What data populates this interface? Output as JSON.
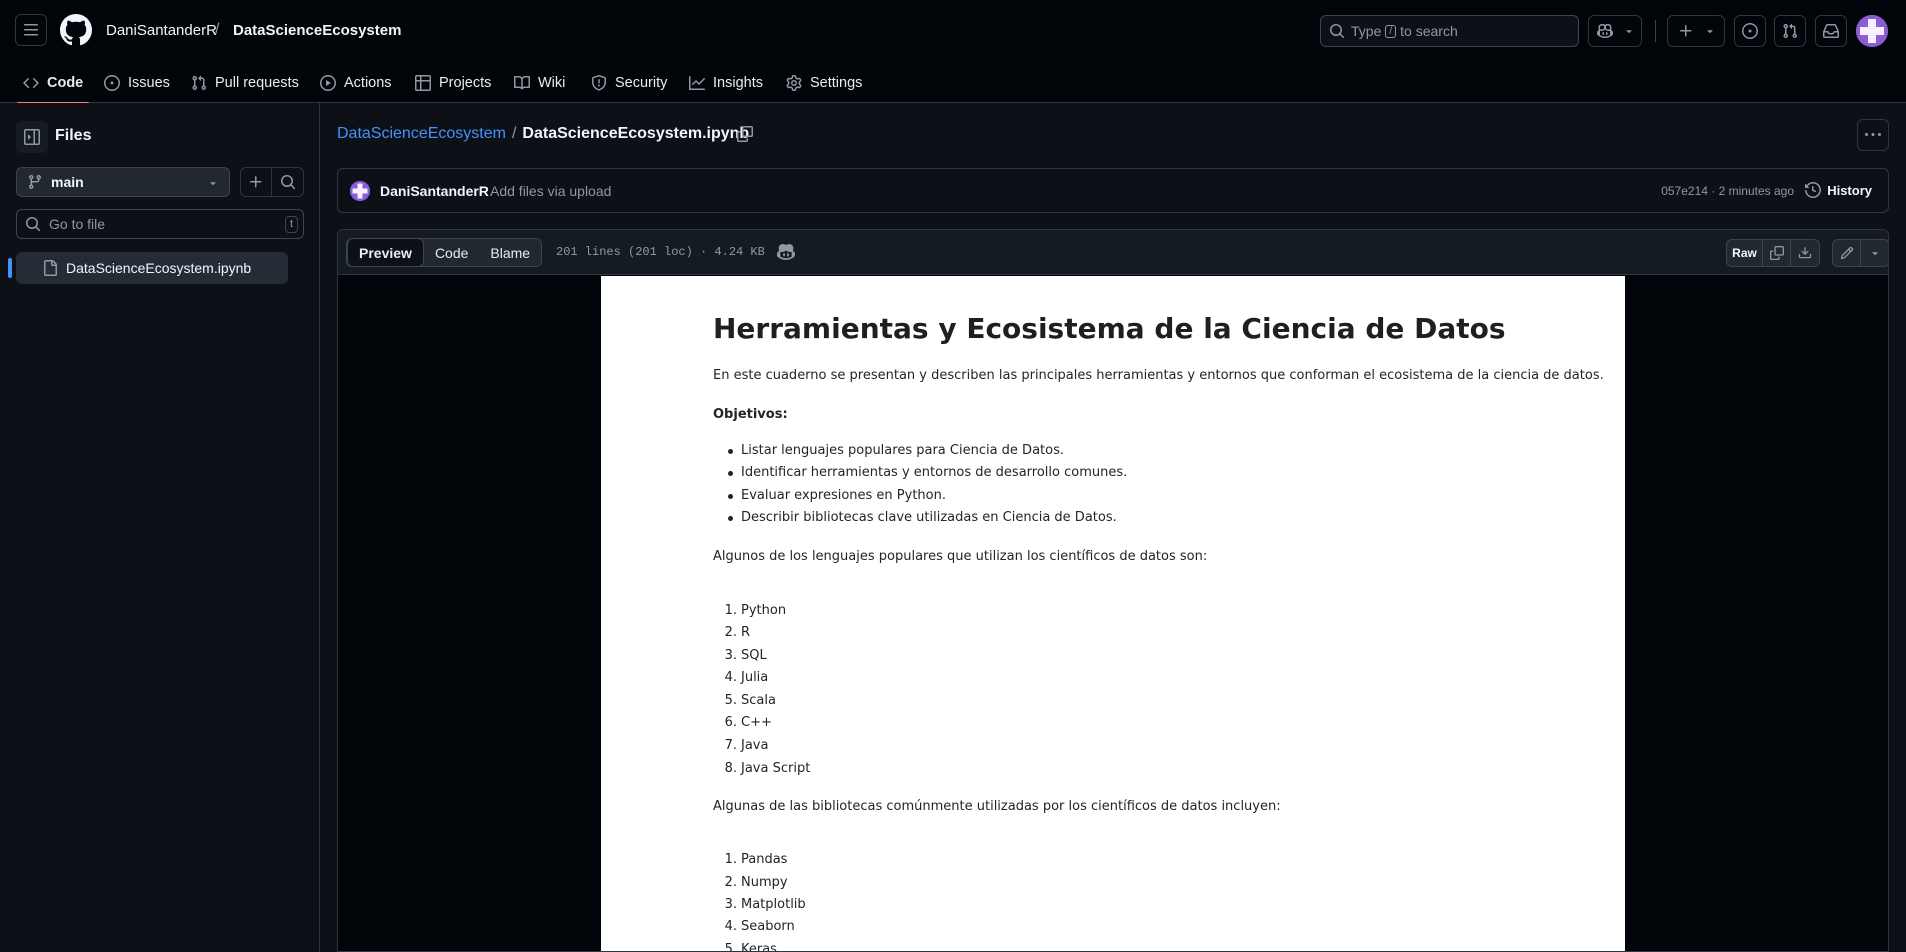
{
  "header": {
    "owner": "DaniSantanderR",
    "separator": "/",
    "repo": "DataScienceEcosystem",
    "search_prefix": "Type",
    "search_key": "/",
    "search_suffix": "to search"
  },
  "repo_nav": [
    {
      "label": "Code",
      "icon": "code-icon",
      "active": true
    },
    {
      "label": "Issues",
      "icon": "issue-icon"
    },
    {
      "label": "Pull requests",
      "icon": "pull-request-icon"
    },
    {
      "label": "Actions",
      "icon": "play-icon"
    },
    {
      "label": "Projects",
      "icon": "table-icon"
    },
    {
      "label": "Wiki",
      "icon": "book-icon"
    },
    {
      "label": "Security",
      "icon": "shield-icon"
    },
    {
      "label": "Insights",
      "icon": "graph-icon"
    },
    {
      "label": "Settings",
      "icon": "gear-icon"
    }
  ],
  "sidebar": {
    "title": "Files",
    "branch": "main",
    "goto_placeholder": "Go to file",
    "goto_key": "t",
    "files": [
      "DataScienceEcosystem.ipynb"
    ]
  },
  "path": {
    "repo": "DataScienceEcosystem",
    "separator": "/",
    "file": "DataScienceEcosystem.ipynb"
  },
  "commit": {
    "author": "DaniSantanderR",
    "message": "Add files via upload",
    "meta": "057e214 · 2 minutes ago",
    "history_label": "History"
  },
  "file_header": {
    "tabs": [
      "Preview",
      "Code",
      "Blame"
    ],
    "active_tab": "Preview",
    "info": "201 lines (201 loc) · 4.24 KB",
    "raw_label": "Raw"
  },
  "notebook": {
    "title": "Herramientas y Ecosistema de la Ciencia de Datos",
    "intro": "En este cuaderno se presentan y describen las principales herramientas y entornos que conforman el ecosistema de la ciencia de datos.",
    "objectives_heading": "Objetivos:",
    "objectives": [
      "Listar lenguajes populares para Ciencia de Datos.",
      "Identificar herramientas y entornos de desarrollo comunes.",
      "Evaluar expresiones en Python.",
      "Describir bibliotecas clave utilizadas en Ciencia de Datos."
    ],
    "languages_intro": "Algunos de los lenguajes populares que utilizan los científicos de datos son:",
    "languages": [
      "Python",
      "R",
      "SQL",
      "Julia",
      "Scala",
      "C++",
      "Java",
      "Java Script"
    ],
    "libraries_intro": "Algunas de las bibliotecas comúnmente utilizadas por los científicos de datos incluyen:",
    "libraries": [
      "Pandas",
      "Numpy",
      "Matplotlib",
      "Seaborn",
      "Keras"
    ]
  }
}
